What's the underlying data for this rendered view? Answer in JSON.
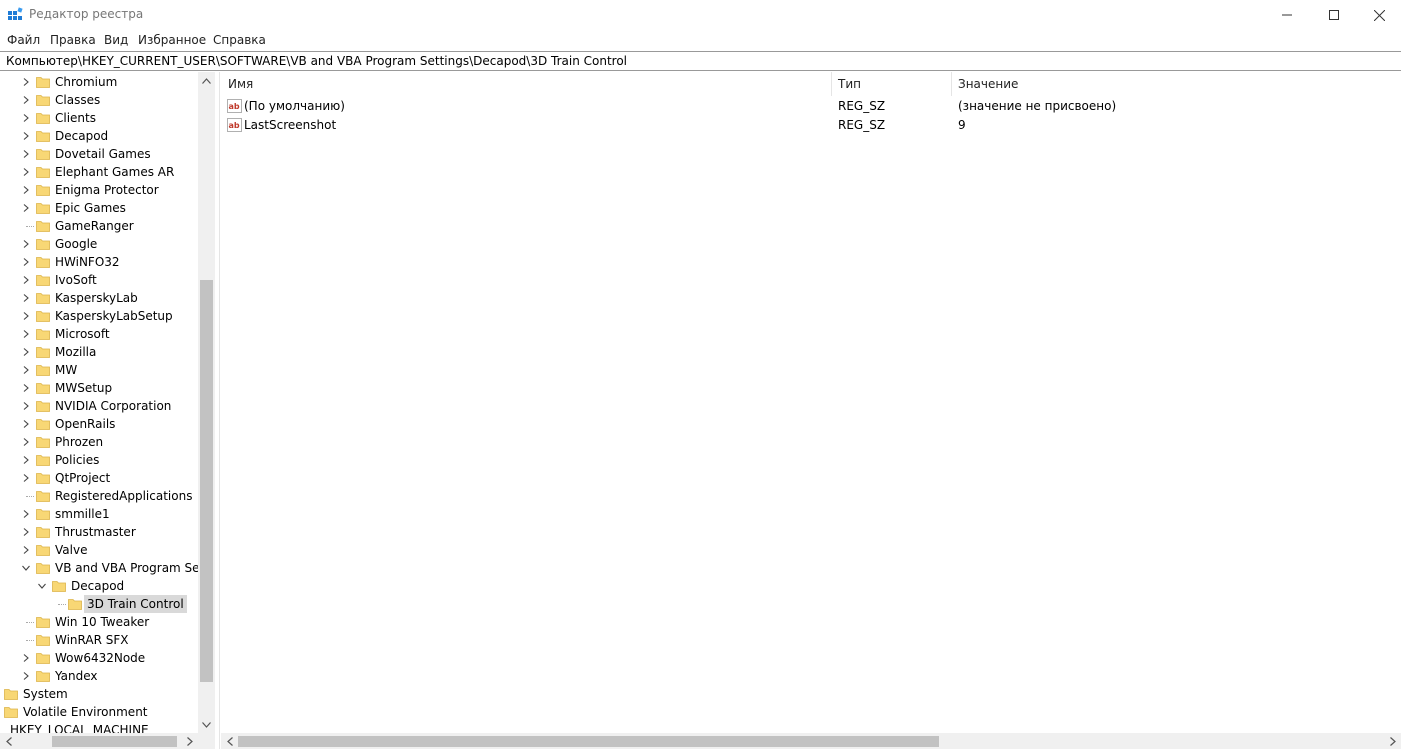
{
  "window": {
    "title": "Редактор реестра",
    "buttons": {
      "minimize": "—",
      "maximize": "☐",
      "close": "✕"
    }
  },
  "menu": [
    "Файл",
    "Правка",
    "Вид",
    "Избранное",
    "Справка"
  ],
  "address": "Компьютер\\HKEY_CURRENT_USER\\SOFTWARE\\VB and VBA Program Settings\\Decapod\\3D Train Control",
  "tree": [
    {
      "label": "Chromium",
      "level": 2,
      "expander": "collapsed"
    },
    {
      "label": "Classes",
      "level": 2,
      "expander": "collapsed"
    },
    {
      "label": "Clients",
      "level": 2,
      "expander": "collapsed"
    },
    {
      "label": "Decapod",
      "level": 2,
      "expander": "collapsed"
    },
    {
      "label": "Dovetail Games",
      "level": 2,
      "expander": "collapsed"
    },
    {
      "label": "Elephant Games AR",
      "level": 2,
      "expander": "collapsed"
    },
    {
      "label": "Enigma Protector",
      "level": 2,
      "expander": "collapsed"
    },
    {
      "label": "Epic Games",
      "level": 2,
      "expander": "collapsed"
    },
    {
      "label": "GameRanger",
      "level": 2,
      "expander": "none"
    },
    {
      "label": "Google",
      "level": 2,
      "expander": "collapsed"
    },
    {
      "label": "HWiNFO32",
      "level": 2,
      "expander": "collapsed"
    },
    {
      "label": "IvoSoft",
      "level": 2,
      "expander": "collapsed"
    },
    {
      "label": "KasperskyLab",
      "level": 2,
      "expander": "collapsed"
    },
    {
      "label": "KasperskyLabSetup",
      "level": 2,
      "expander": "collapsed"
    },
    {
      "label": "Microsoft",
      "level": 2,
      "expander": "collapsed"
    },
    {
      "label": "Mozilla",
      "level": 2,
      "expander": "collapsed"
    },
    {
      "label": "MW",
      "level": 2,
      "expander": "collapsed"
    },
    {
      "label": "MWSetup",
      "level": 2,
      "expander": "collapsed"
    },
    {
      "label": "NVIDIA Corporation",
      "level": 2,
      "expander": "collapsed"
    },
    {
      "label": "OpenRails",
      "level": 2,
      "expander": "collapsed"
    },
    {
      "label": "Phrozen",
      "level": 2,
      "expander": "collapsed"
    },
    {
      "label": "Policies",
      "level": 2,
      "expander": "collapsed"
    },
    {
      "label": "QtProject",
      "level": 2,
      "expander": "collapsed"
    },
    {
      "label": "RegisteredApplications",
      "level": 2,
      "expander": "none"
    },
    {
      "label": "smmille1",
      "level": 2,
      "expander": "collapsed"
    },
    {
      "label": "Thrustmaster",
      "level": 2,
      "expander": "collapsed"
    },
    {
      "label": "Valve",
      "level": 2,
      "expander": "collapsed"
    },
    {
      "label": "VB and VBA Program Settings",
      "level": 2,
      "expander": "expanded"
    },
    {
      "label": "Decapod",
      "level": 3,
      "expander": "expanded"
    },
    {
      "label": "3D Train Control",
      "level": 4,
      "expander": "none",
      "selected": true
    },
    {
      "label": "Win 10 Tweaker",
      "level": 2,
      "expander": "none"
    },
    {
      "label": "WinRAR SFX",
      "level": 2,
      "expander": "none"
    },
    {
      "label": "Wow6432Node",
      "level": 2,
      "expander": "collapsed"
    },
    {
      "label": "Yandex",
      "level": 2,
      "expander": "collapsed"
    },
    {
      "label": "System",
      "level": 1,
      "expander": "none"
    },
    {
      "label": "Volatile Environment",
      "level": 1,
      "expander": "none"
    },
    {
      "label": "HKEY_LOCAL_MACHINE",
      "level": 0,
      "expander": "none"
    }
  ],
  "columns": {
    "name": "Имя",
    "type": "Тип",
    "value": "Значение"
  },
  "values": [
    {
      "name": "(По умолчанию)",
      "type": "REG_SZ",
      "data": "(значение не присвоено)"
    },
    {
      "name": "LastScreenshot",
      "type": "REG_SZ",
      "data": "9"
    }
  ],
  "icons": {
    "folder": "folder-icon",
    "string_value": "string-value-icon",
    "app": "regedit-icon"
  },
  "colors": {
    "folder": "#f8d775",
    "folder_edge": "#dcb44a",
    "selection": "#d9d9d9",
    "ab_red": "#c0392b"
  }
}
